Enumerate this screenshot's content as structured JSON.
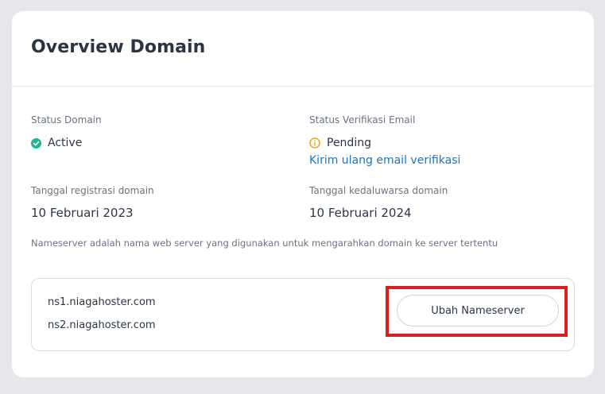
{
  "card": {
    "title": "Overview Domain"
  },
  "status_domain": {
    "label": "Status Domain",
    "value": "Active",
    "icon": "check-circle-icon",
    "color": "#1fb58f"
  },
  "status_email": {
    "label": "Status Verifikasi Email",
    "value": "Pending",
    "icon": "info-circle-icon",
    "color": "#f0a820",
    "resend_link": "Kirim ulang email verifikasi"
  },
  "registration": {
    "label": "Tanggal registrasi domain",
    "value": "10 Februari 2023"
  },
  "expiration": {
    "label": "Tanggal kedaluwarsa domain",
    "value": "10 Februari 2024"
  },
  "nameserver_note": "Nameserver adalah nama web server yang digunakan untuk mengarahkan domain ke server tertentu",
  "nameservers": [
    "ns1.niagahoster.com",
    "ns2.niagahoster.com"
  ],
  "change_button": "Ubah Nameserver",
  "colors": {
    "link": "#1a73c8",
    "highlight": "#d81e24"
  }
}
